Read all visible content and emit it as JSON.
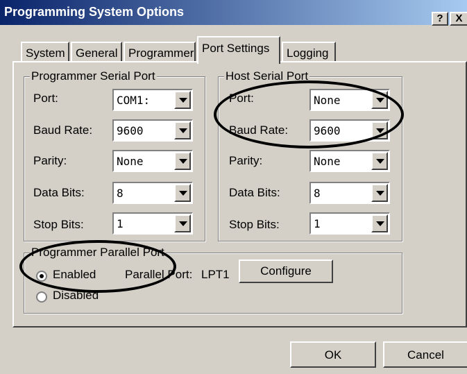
{
  "window": {
    "title": "Programming System Options",
    "help_label": "?",
    "close_label": "X"
  },
  "tabs": [
    {
      "label": "System"
    },
    {
      "label": "General"
    },
    {
      "label": "Programmer"
    },
    {
      "label": "Port Settings",
      "active": true
    },
    {
      "label": "Logging"
    }
  ],
  "programmer_serial": {
    "title": "Programmer Serial Port",
    "fields": [
      {
        "label": "Port:",
        "value": "COM1:"
      },
      {
        "label": "Baud Rate:",
        "value": "9600"
      },
      {
        "label": "Parity:",
        "value": "None"
      },
      {
        "label": "Data Bits:",
        "value": "8"
      },
      {
        "label": "Stop Bits:",
        "value": "1"
      }
    ]
  },
  "host_serial": {
    "title": "Host Serial Port",
    "fields": [
      {
        "label": "Port:",
        "value": "None"
      },
      {
        "label": "Baud Rate:",
        "value": "9600"
      },
      {
        "label": "Parity:",
        "value": "None"
      },
      {
        "label": "Data Bits:",
        "value": "8"
      },
      {
        "label": "Stop Bits:",
        "value": "1"
      }
    ]
  },
  "parallel": {
    "title": "Programmer Parallel Port",
    "enabled_label": "Enabled",
    "disabled_label": "Disabled",
    "selected": "Enabled",
    "port_label": "Parallel Port:",
    "port_value": "LPT1",
    "configure_label": "Configure"
  },
  "footer": {
    "ok_label": "OK",
    "cancel_label": "Cancel"
  }
}
